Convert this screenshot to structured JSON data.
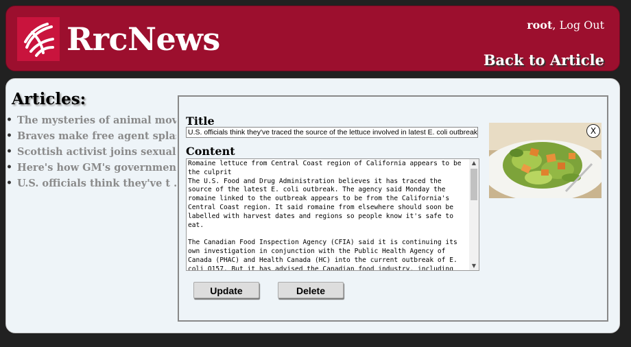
{
  "header": {
    "brand": "RrcNews",
    "username": "root",
    "separator": ",",
    "logout_label": "Log Out",
    "back_label": "Back to Article",
    "colors": {
      "banner": "#9c0f2e",
      "logo_bg": "#c9143d"
    }
  },
  "sidebar": {
    "title": "Articles:",
    "items": [
      {
        "label": "The mysteries of animal moveme ..."
      },
      {
        "label": "Braves make free agent splash ..."
      },
      {
        "label": "Scottish activist joins sexual ..."
      },
      {
        "label": "Here's how GM's government sub"
      },
      {
        "label": "U.S. officials think they've t ..."
      }
    ]
  },
  "editor": {
    "title_label": "Title",
    "title_value": "U.S. officials think they've traced the source of the lettuce involved in latest E. coli outbreak",
    "content_label": "Content",
    "content_value": "Romaine lettuce from Central Coast region of California appears to be the culprit\nThe U.S. Food and Drug Administration believes it has traced the source of the latest E. coli outbreak. The agency said Monday the romaine linked to the outbreak appears to be from the California's Central Coast region. It said romaine from elsewhere should soon be labelled with harvest dates and regions so people know it's safe to eat.\n\nThe Canadian Food Inspection Agency (CFIA) said it is continuing its own investigation in conjunction with the Public Health Agency of Canada (PHAC) and Health Canada (HC) into the current outbreak of E. coli O157. But it has advised the Canadian food industry, including",
    "update_label": "Update",
    "delete_label": "Delete",
    "image": {
      "icon": "salad-photo",
      "close_label": "X"
    }
  }
}
